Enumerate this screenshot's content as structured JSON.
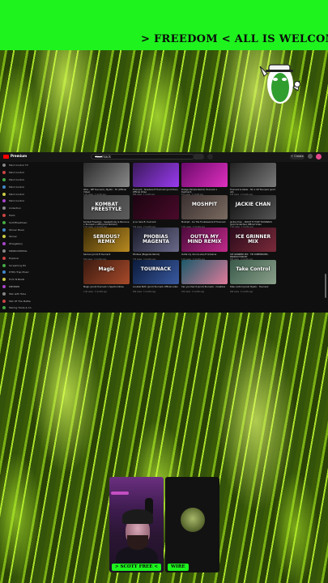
{
  "ticker": {
    "text": "> FREEDOM < ALL IS WELCOME LIKE & S"
  },
  "colors": {
    "accent_green": "#1ef31e",
    "youtube_red": "#ff0000"
  },
  "youtube": {
    "logo_text": "Premium",
    "search_value": "tourmack",
    "create_label": "+ Create",
    "tabs": [
      "Home",
      "Videos",
      "Shorts",
      "Posts"
    ],
    "active_tab": "Videos",
    "subscriptions": [
      "Mind Control TV",
      "Mind Control",
      "Mind Control",
      "Mind Control",
      "Mind Control",
      "Mind Control",
      "Collection",
      "Hello",
      "ScottFreeMusic",
      "Stoner Music",
      "Stoner",
      "Wiregallery",
      "MINDCONTROL",
      "Explorer",
      "Screaming Pol",
      "DTRS Trap Music",
      "Trick N Beats",
      "DBNNRR",
      "Talk with Tube",
      "Talk Of The Matter",
      "Talking Trade & Co",
      "Bass",
      "Tamado",
      "Tallest",
      "Tuned Electric",
      "Tune Six Music",
      "Tune Everett"
    ],
    "videos": [
      {
        "thumb": "",
        "title": "Wolv - WE Tournack | Mystic - FX (Official Video)",
        "meta": "1.2K views · 1 month ago",
        "c1": "#2b2b2b",
        "c2": "#8a8a8a"
      },
      {
        "thumb": "",
        "title": "Tournack - Nowhere ft Tournack (prod Dao) Official Video",
        "meta": "980 views · 1 month ago",
        "c1": "#3a1a5a",
        "c2": "#9a3af0"
      },
      {
        "thumb": "",
        "title": "Dodge (Temple Remix) Tournack x Dadmech",
        "meta": "870 views · 1 month ago",
        "c1": "#6a0a6a",
        "c2": "#e030c0"
      },
      {
        "thumb": "",
        "title": "Tournack & Keller - Mo 1 SH Tournack (prod AK)",
        "meta": "640 views · 2 months ago",
        "c1": "#202020",
        "c2": "#7a7a7a"
      },
      {
        "thumb": "KOMBAT FREESTYLE",
        "title": "Kombat Freestyle - Speaksfunky & Baconne x Tournack x ATM (prod Nicholx)",
        "meta": "2.1K views · 2 months ago",
        "c1": "#3b3b3b",
        "c2": "#5c5c5c"
      },
      {
        "thumb": "",
        "title": "Jo so here ft. tournack",
        "meta": "410 views · 2 months ago",
        "c1": "#1a0410",
        "c2": "#4a0a2a"
      },
      {
        "thumb": "MOSHPIT",
        "title": "Moshpit - Ice The Troublesome ft Tournack",
        "meta": "1.6K views · 3 months ago",
        "c1": "#3a3030",
        "c2": "#7a6a60"
      },
      {
        "thumb": "JACKIE CHAN",
        "title": "Jackie Chan - SKOUT ft TOMI TOURNACK (prod Scratchie) Official Video",
        "meta": "3.3K views · 3 months ago",
        "c1": "#111111",
        "c2": "#555555"
      },
      {
        "thumb": "SERIOUS? REMIX",
        "title": "Serious (prod) ft tournack",
        "meta": "520 views · 3 months ago",
        "c1": "#3a2a08",
        "c2": "#b88a20"
      },
      {
        "thumb": "PHOBIAS MAGENTA",
        "title": "Phobias (Magenta Remix)",
        "meta": "770 views · 4 months ago",
        "c1": "#1a1a2a",
        "c2": "#6a6a8a"
      },
      {
        "thumb": "OUTTA MY MIND REMIX",
        "title": "Outta my mind (Luke) ft Qinkerss",
        "meta": "1.1K views · 4 months ago",
        "c1": "#4a0a3a",
        "c2": "#c02a8a"
      },
      {
        "thumb": "ICE GRINNER MIX",
        "title": "ICE GRINNER MIX · TRI DIMENSIONS · PRODUCTION BY",
        "meta": "890 views · 4 months ago",
        "c1": "#2a0a1a",
        "c2": "#7a2a3a"
      },
      {
        "thumb": "Magic",
        "title": "Magic (prod) Tournack x Spectrumtree",
        "meta": "1.4K views · 5 months ago",
        "c1": "#3a1a10",
        "c2": "#a84a2a"
      },
      {
        "thumb": "TOURNACK",
        "title": "Lucable Both (prod) Tournack Official video",
        "meta": "560 views · 5 months ago",
        "c1": "#0a1a3a",
        "c2": "#3a5aa0"
      },
      {
        "thumb": "",
        "title": "Can you feel it (prod) Tournack - Creatlive",
        "meta": "700 views · 5 months ago",
        "c1": "#1a5a6a",
        "c2": "#e07a9a"
      },
      {
        "thumb": "Take Control",
        "title": "Take control (prod) Mystic · Tournack",
        "meta": "480 views · 6 months ago",
        "c1": "#3a5a4a",
        "c2": "#8aa08a"
      }
    ]
  },
  "cams": {
    "main_name": "> SCOTT FREE <",
    "guest_name": "WIRE"
  }
}
